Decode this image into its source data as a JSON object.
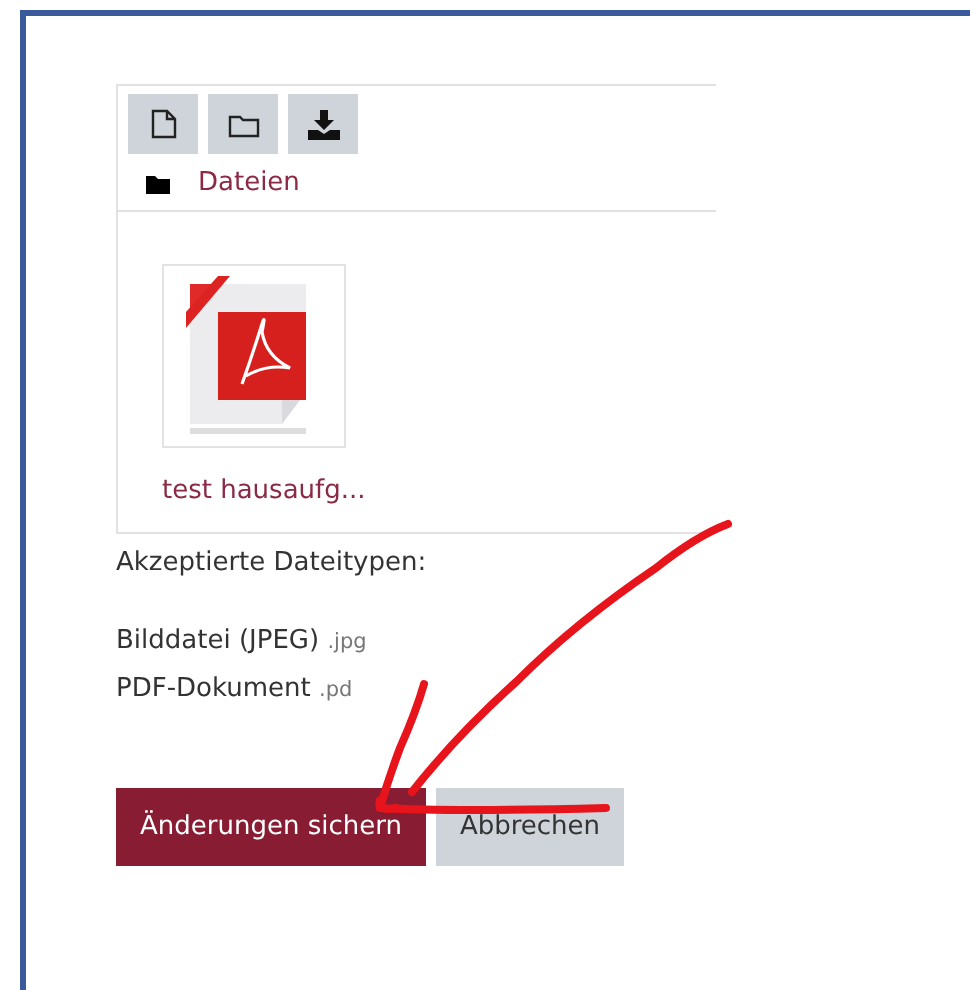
{
  "filemanager": {
    "path_label": "Dateien",
    "files": [
      {
        "name": "test hausaufg...",
        "kind": "pdf"
      }
    ]
  },
  "accepted_types": {
    "heading": "Akzeptierte Dateitypen:",
    "types": [
      {
        "name": "Bilddatei (JPEG)",
        "extension": ".jpg"
      },
      {
        "name": "PDF-Dokument",
        "extension": ".pd"
      }
    ]
  },
  "buttons": [
    {
      "label": "Änderungen sichern",
      "kind": "primary"
    },
    {
      "label": "Abbrechen",
      "kind": "secondary"
    }
  ],
  "annotation": {
    "kind": "arrow"
  }
}
